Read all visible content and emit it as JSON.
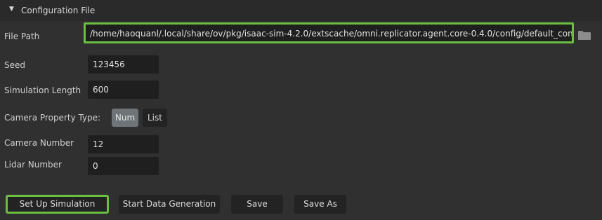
{
  "header": {
    "title": "Configuration File",
    "expand_icon": "triangle-down-icon"
  },
  "file_path": {
    "label": "File Path",
    "value": "/home/haoquanl/.local/share/ov/pkg/isaac-sim-4.2.0/extscache/omni.replicator.agent.core-0.4.0/config/default_config.yaml",
    "browse_icon": "folder-icon"
  },
  "seed": {
    "label": "Seed",
    "value": "123456"
  },
  "simulation_length": {
    "label": "Simulation Length",
    "value": "600"
  },
  "camera_property_type": {
    "label": "Camera Property Type:",
    "options": [
      "Num",
      "List"
    ],
    "selected": "Num"
  },
  "camera_number": {
    "label": "Camera Number",
    "value": "12"
  },
  "lidar_number": {
    "label": "Lidar Number",
    "value": "0"
  },
  "buttons": {
    "setup": "Set Up Simulation",
    "start": "Start Data Generation",
    "save": "Save",
    "save_as": "Save As"
  },
  "colors": {
    "highlight": "#6abf40",
    "background": "#303030",
    "field": "#1f1f1f",
    "selected_toggle": "#6e7478"
  }
}
